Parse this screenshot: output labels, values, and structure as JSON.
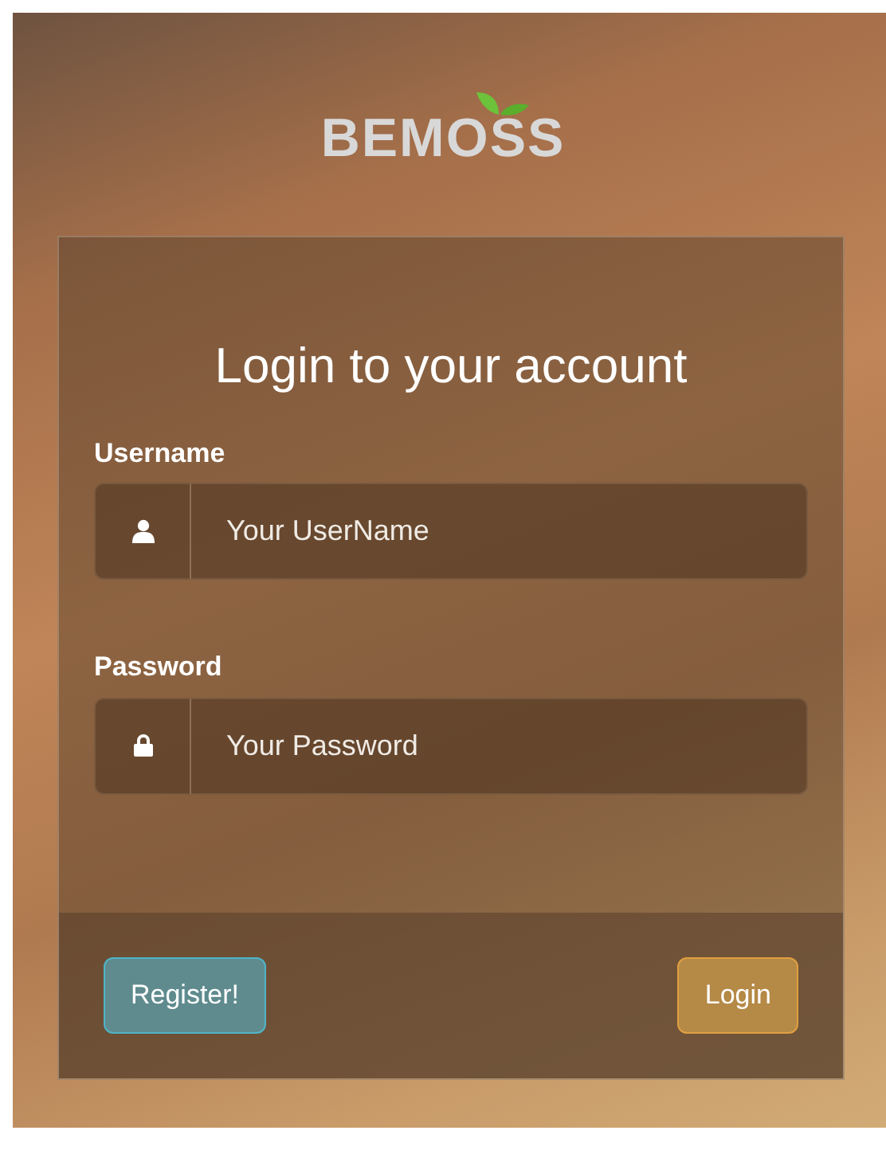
{
  "logo": "BEMOSS",
  "title": "Login to your account",
  "fields": [
    {
      "label": "Username",
      "placeholder": "Your UserName",
      "kind": "user"
    },
    {
      "label": "Password",
      "placeholder": "Your Password",
      "kind": "lock"
    }
  ],
  "buttons": [
    {
      "label": "Register!",
      "kind": "info"
    },
    {
      "label": "Login",
      "kind": "warning"
    }
  ]
}
